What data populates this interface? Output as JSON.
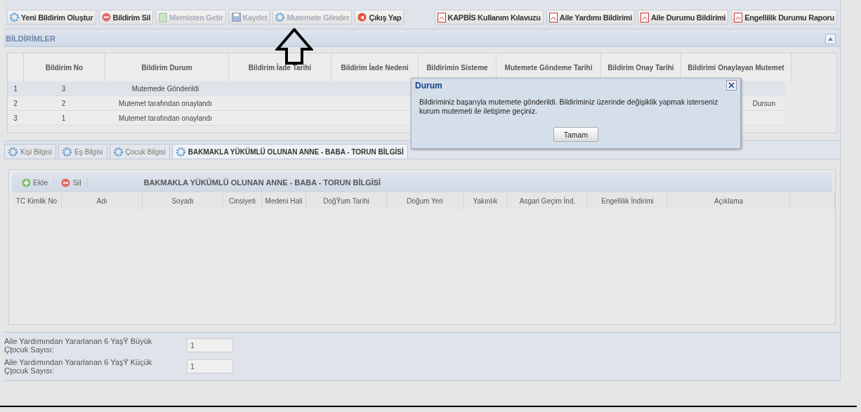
{
  "toolbar": {
    "left": [
      {
        "label": "Yeni Bildirim Oluştur",
        "kind": "gear",
        "disabled": false
      },
      {
        "label": "Bildirim Sil",
        "kind": "minus",
        "disabled": false
      },
      {
        "label": "Mernisten Getir",
        "kind": "doc",
        "disabled": true
      },
      {
        "label": "Kaydet",
        "kind": "save",
        "disabled": true
      },
      {
        "label": "Mutemete Gönder",
        "kind": "gear",
        "disabled": true
      },
      {
        "label": "Çıkış Yap",
        "kind": "exit",
        "disabled": false
      }
    ],
    "right": [
      {
        "label": "KAPBİS Kullanım Kılavuzu",
        "kind": "pdf",
        "disabled": false
      },
      {
        "label": "Aile Yardımı Bildirimi",
        "kind": "pdf",
        "disabled": false
      },
      {
        "label": "Aile Durumu Bildirimi",
        "kind": "pdf",
        "disabled": false
      },
      {
        "label": "Engellilik Durumu Raporu",
        "kind": "pdf",
        "disabled": false
      }
    ]
  },
  "notifications": {
    "title": "BİLDİRİMLER",
    "columns": [
      "Bildirim No",
      "Bildirim Durum",
      "Bildirim İade Tarihi",
      "Bildirim İade Nedeni",
      "Bildirimin Sisteme",
      "Mutemete Göndeme Tarihi",
      "Bildirim Onay Tarihi",
      "Bildirimi Onaylayan Mutemet"
    ],
    "rows": [
      {
        "index": "1",
        "selected": true,
        "cells": [
          "3",
          "Mutemede Gönderildi",
          "",
          "",
          "",
          "",
          "",
          ""
        ]
      },
      {
        "index": "2",
        "selected": false,
        "cells": [
          "2",
          "Mutemet tarafından onaylandı",
          "",
          "",
          "",
          "",
          "",
          "Dursun"
        ]
      },
      {
        "index": "3",
        "selected": false,
        "cells": [
          "1",
          "Mutemet tarafından onaylandı",
          "",
          "",
          "",
          "",
          "",
          ""
        ]
      }
    ]
  },
  "dialog": {
    "title": "Durum",
    "message": "Bildiriminiz başarıyla mutemete gönderildi. Bildiriminiz üzerinde değişiklik yapmak isterseniz kurum mutemeti ile iletişime geçiniz.",
    "button": "Tamam"
  },
  "tabs": [
    {
      "label": "Kişi Bilgisi",
      "selected": false
    },
    {
      "label": "Eş Bilgisi",
      "selected": false
    },
    {
      "label": "Çocuk Bilgisi",
      "selected": false
    },
    {
      "label": "BAKMAKLA YÜKÜMLÜ OLUNAN ANNE - BABA - TORUN BİLGİSİ",
      "selected": true
    }
  ],
  "grid": {
    "actions": [
      {
        "label": "Ekle",
        "kind": "plus"
      },
      {
        "label": "Sil",
        "kind": "minus"
      }
    ],
    "title": "BAKMAKLA YÜKÜMLÜ OLUNAN ANNE - BABA - TORUN BİLGİSİ",
    "columns": [
      "TC Kimlik No",
      "Adı",
      "Soyadı",
      "Cinsiyeti",
      "Medeni Hali",
      "DoğŸum Tarihi",
      "Doğum Yeri",
      "Yakınlık",
      "Asgari Geçim İnd.",
      "Engellilik İndirimi",
      "Açıklama"
    ]
  },
  "fields": [
    {
      "label": "Aile Yardımından Yararlanan 6 YaşŸ Büyük Çţocuk Sayısı:",
      "value": "1"
    },
    {
      "label": "Aile Yardımından Yararlanan 6 YaşŸ Küçük Çţocuk Sayısı:",
      "value": "1"
    }
  ]
}
